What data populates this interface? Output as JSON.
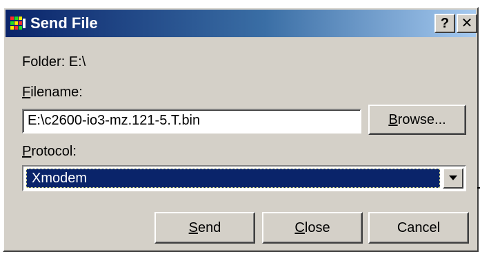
{
  "window": {
    "title": "Send File",
    "help_glyph": "?",
    "close_glyph": "✕",
    "icon": "send-file-app-icon"
  },
  "folder": {
    "label": "Folder:",
    "value": "E:\\"
  },
  "filename": {
    "label_mnemonic": "F",
    "label_rest": "ilename:",
    "value": "E:\\c2600-io3-mz.121-5.T.bin"
  },
  "browse_button": {
    "mnemonic": "B",
    "rest": "rowse..."
  },
  "protocol": {
    "label_mnemonic": "P",
    "label_rest": "rotocol:",
    "selected": "Xmodem"
  },
  "buttons": {
    "send": {
      "mnemonic": "S",
      "rest": "end"
    },
    "close": {
      "mnemonic": "C",
      "rest": "lose"
    },
    "cancel": {
      "label": "Cancel"
    }
  },
  "colors": {
    "title_gradient_start": "#0a246a",
    "title_gradient_end": "#a6caf0",
    "dialog_face": "#d4d0c8",
    "selection": "#0a246a"
  }
}
